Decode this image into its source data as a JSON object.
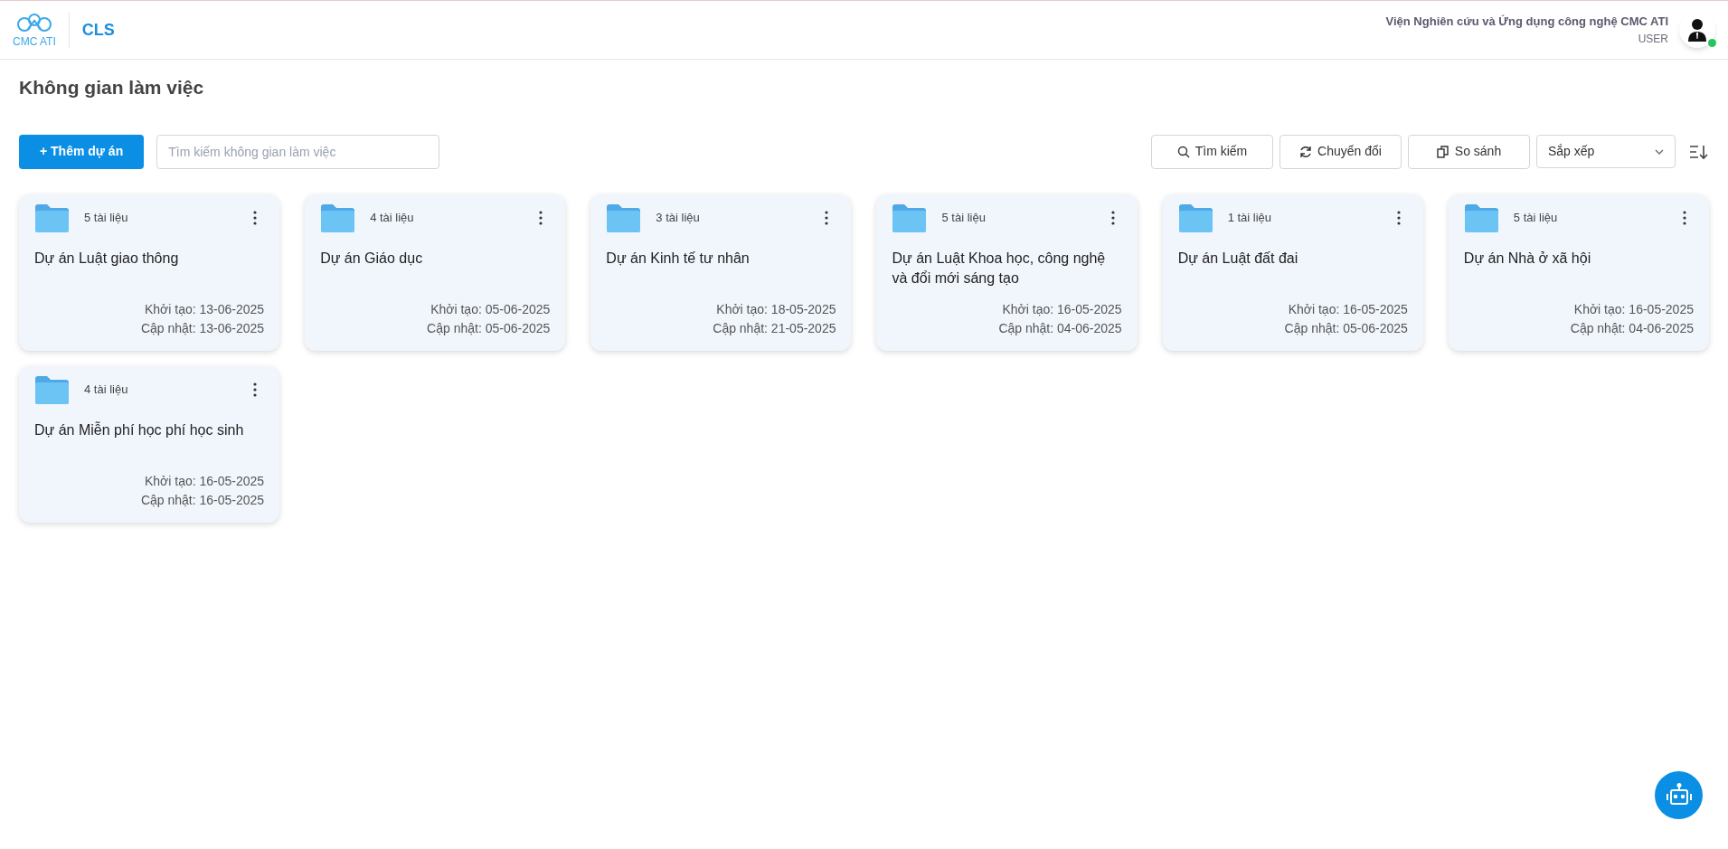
{
  "header": {
    "logo_text": "CMC ATI",
    "app_name": "CLS",
    "org_name": "Viện Nghiên cứu và Ứng dụng công nghệ CMC ATI",
    "role": "USER",
    "online": true
  },
  "page_title": "Không gian làm việc",
  "toolbar": {
    "add_button": "+ Thêm dự án",
    "search": {
      "placeholder": "Tìm kiếm không gian làm việc"
    },
    "buttons": [
      {
        "kind": "search",
        "label": "Tìm kiếm"
      },
      {
        "kind": "convert",
        "label": "Chuyển đổi"
      },
      {
        "kind": "compare",
        "label": "So sánh"
      }
    ],
    "sort_select": "Sắp xếp"
  },
  "projects": [
    {
      "count": "5 tài liệu",
      "name": "Dự án Luật giao thông",
      "created": "Khởi tạo: 13-06-2025",
      "updated": "Cập nhật: 13-06-2025"
    },
    {
      "count": "4 tài liệu",
      "name": "Dự án Giáo dục",
      "created": "Khởi tạo: 05-06-2025",
      "updated": "Cập nhật: 05-06-2025"
    },
    {
      "count": "3 tài liệu",
      "name": "Dự án Kinh tế tư nhân",
      "created": "Khởi tạo: 18-05-2025",
      "updated": "Cập nhật: 21-05-2025"
    },
    {
      "count": "5 tài liệu",
      "name": "Dự án Luật Khoa học, công nghệ và đổi mới sáng tạo",
      "created": "Khởi tạo: 16-05-2025",
      "updated": "Cập nhật: 04-06-2025"
    },
    {
      "count": "1 tài liệu",
      "name": "Dự án Luật đất đai",
      "created": "Khởi tạo: 16-05-2025",
      "updated": "Cập nhật: 05-06-2025"
    },
    {
      "count": "5 tài liệu",
      "name": "Dự án Nhà ở xã hội",
      "created": "Khởi tạo: 16-05-2025",
      "updated": "Cập nhật: 04-06-2025"
    },
    {
      "count": "4 tài liệu",
      "name": "Dự án Miễn phí học phí học sinh",
      "created": "Khởi tạo: 16-05-2025",
      "updated": "Cập nhật: 16-05-2025"
    }
  ]
}
